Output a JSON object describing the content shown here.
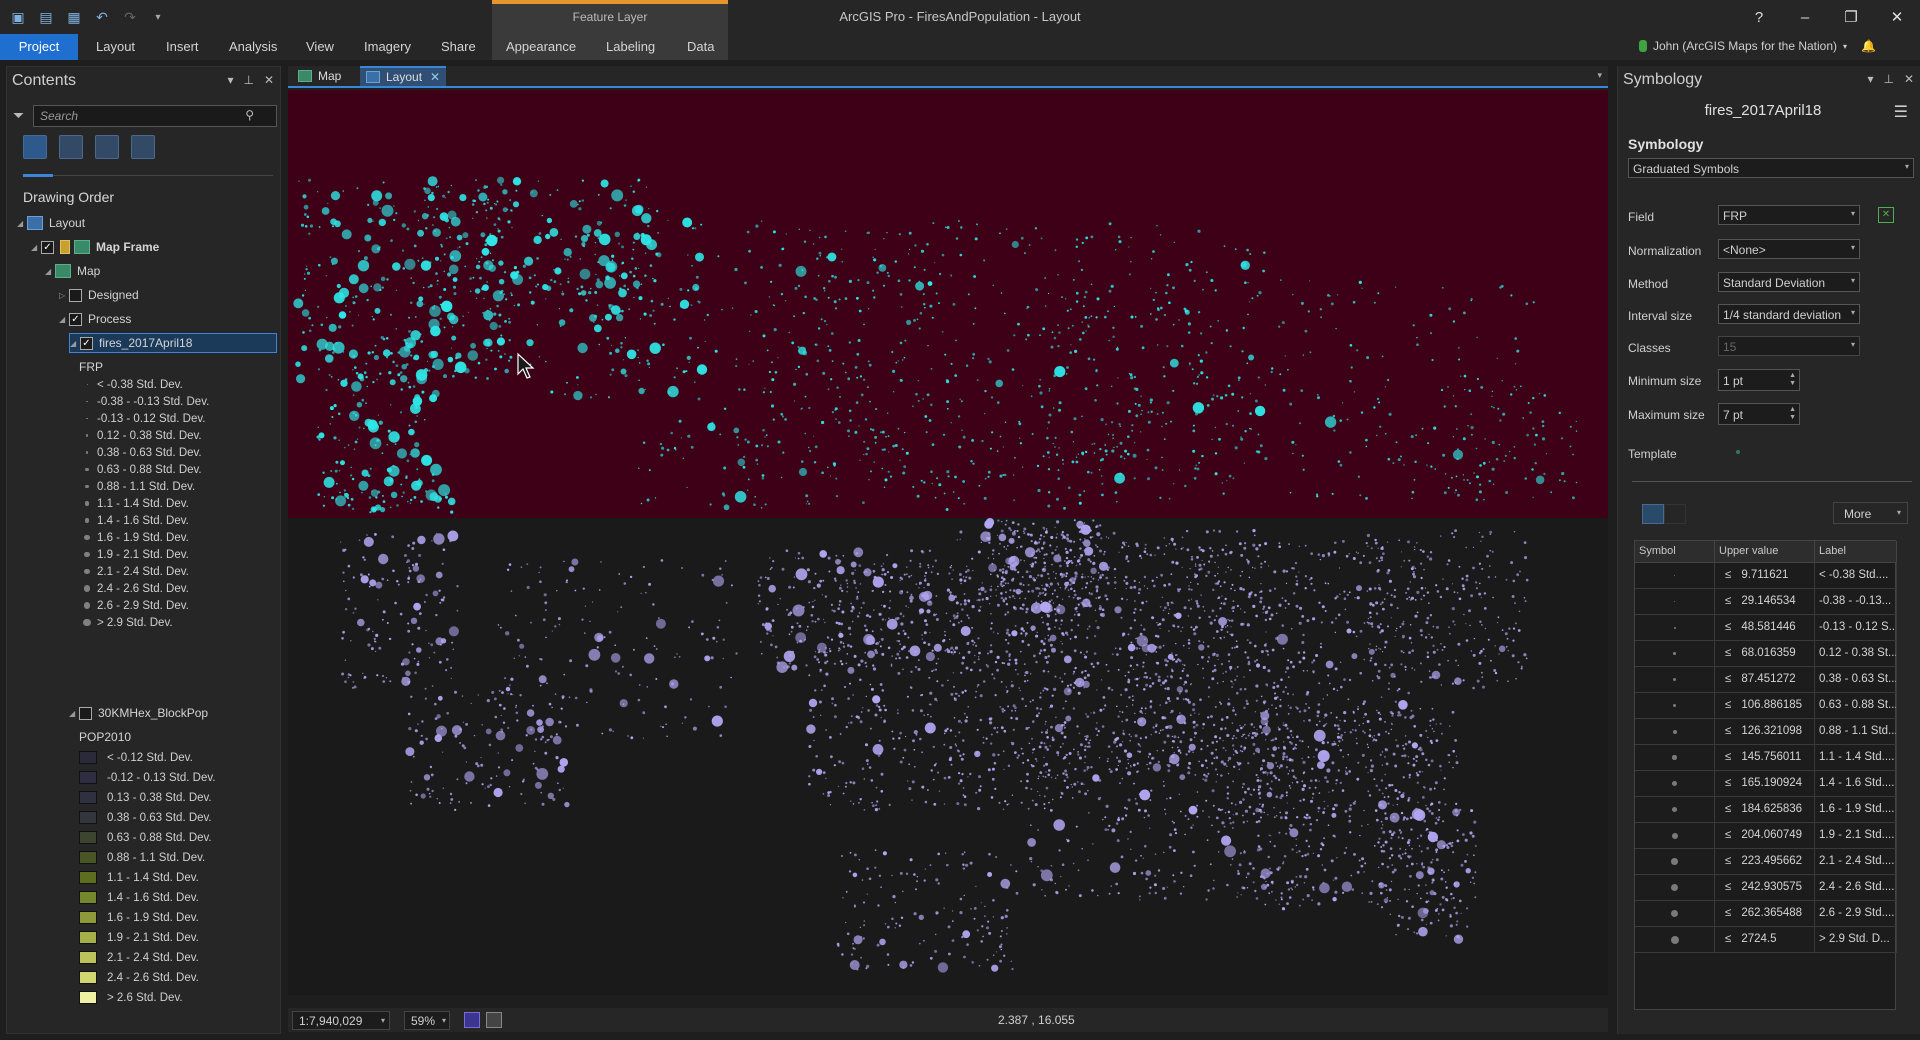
{
  "window": {
    "title": "ArcGIS Pro - FiresAndPopulation - Layout",
    "context_tab_title": "Feature Layer",
    "controls": [
      "?",
      "–",
      "❐",
      "✕"
    ]
  },
  "quick_access": [
    "project-icon",
    "open-icon",
    "save-icon",
    "undo-icon",
    "redo-icon",
    "customize-icon"
  ],
  "ribbon": {
    "tabs": [
      "Project",
      "Layout",
      "Insert",
      "Analysis",
      "View",
      "Imagery",
      "Share",
      "Appearance",
      "Labeling",
      "Data"
    ],
    "user": "John (ArcGIS Maps for the Nation)"
  },
  "contents": {
    "title": "Contents",
    "search_placeholder": "Search",
    "drawing_order": "Drawing Order",
    "tree": {
      "layout": "Layout",
      "map_frame": "Map Frame",
      "map": "Map",
      "designed": "Designed",
      "process": "Process",
      "fires_layer": "fires_2017April18",
      "fires_field": "FRP",
      "fires_classes": [
        "< -0.38 Std. Dev.",
        "-0.38 - -0.13 Std. Dev.",
        "-0.13 - 0.12 Std. Dev.",
        "0.12 - 0.38 Std. Dev.",
        "0.38 - 0.63 Std. Dev.",
        "0.63 - 0.88 Std. Dev.",
        "0.88 - 1.1 Std. Dev.",
        "1.1 - 1.4 Std. Dev.",
        "1.4 - 1.6 Std. Dev.",
        "1.6 - 1.9 Std. Dev.",
        "1.9 - 2.1 Std. Dev.",
        "2.1 - 2.4 Std. Dev.",
        "2.4 - 2.6 Std. Dev.",
        "2.6 - 2.9 Std. Dev.",
        "> 2.9 Std. Dev."
      ],
      "hex_layer": "30KMHex_BlockPop",
      "hex_field": "POP2010",
      "hex_classes": [
        "< -0.12 Std. Dev.",
        "-0.12 - 0.13 Std. Dev.",
        "0.13 - 0.38 Std. Dev.",
        "0.38 - 0.63 Std. Dev.",
        "0.63 - 0.88 Std. Dev.",
        "0.88 - 1.1 Std. Dev.",
        "1.1 - 1.4 Std. Dev.",
        "1.4 - 1.6 Std. Dev.",
        "1.6 - 1.9 Std. Dev.",
        "1.9 - 2.1 Std. Dev.",
        "2.1 - 2.4 Std. Dev.",
        "2.4 - 2.6 Std. Dev.",
        "> 2.6 Std. Dev."
      ],
      "hex_colors": [
        "#2a2a3a",
        "#2e2d42",
        "#2f3040",
        "#33363c",
        "#3d4430",
        "#4a5526",
        "#5f6e1e",
        "#76862a",
        "#8e9a3a",
        "#a5b048",
        "#bcc35a",
        "#d2d672",
        "#eef0a4"
      ]
    }
  },
  "doc_tabs": {
    "map": "Map",
    "layout": "Layout"
  },
  "status": {
    "scale": "1:7,940,029",
    "zoom": "59%",
    "coords": "2.387 , 16.055"
  },
  "map_colors": {
    "top_bg": "#3d0016",
    "bottom_bg": "#1a1a1a",
    "fire": "#2ee6e6",
    "pop": "#b3a6f2"
  },
  "symbology": {
    "pane_title": "Symbology",
    "layer": "fires_2017April18",
    "heading": "Symbology",
    "renderer": "Graduated Symbols",
    "field_label": "Field",
    "field": "FRP",
    "normalization_label": "Normalization",
    "normalization": "<None>",
    "method_label": "Method",
    "method": "Standard Deviation",
    "interval_label": "Interval size",
    "interval": "1/4 standard deviation",
    "classes_label": "Classes",
    "classes": "15",
    "min_label": "Minimum size",
    "min": "1 pt",
    "max_label": "Maximum size",
    "max": "7 pt",
    "template_label": "Template",
    "more": "More",
    "table_headers": [
      "Symbol",
      "Upper value",
      "Label"
    ],
    "rows": [
      {
        "upper": "9.711621",
        "label": "< -0.38 Std...."
      },
      {
        "upper": "29.146534",
        "label": "-0.38 - -0.13..."
      },
      {
        "upper": "48.581446",
        "label": "-0.13 - 0.12 S..."
      },
      {
        "upper": "68.016359",
        "label": "0.12 - 0.38 St..."
      },
      {
        "upper": "87.451272",
        "label": "0.38 - 0.63 St..."
      },
      {
        "upper": "106.886185",
        "label": "0.63 - 0.88 St..."
      },
      {
        "upper": "126.321098",
        "label": "0.88 - 1.1 Std...."
      },
      {
        "upper": "145.756011",
        "label": "1.1 - 1.4 Std...."
      },
      {
        "upper": "165.190924",
        "label": "1.4 - 1.6 Std...."
      },
      {
        "upper": "184.625836",
        "label": "1.6 - 1.9 Std...."
      },
      {
        "upper": "204.060749",
        "label": "1.9 - 2.1 Std...."
      },
      {
        "upper": "223.495662",
        "label": "2.1 - 2.4 Std...."
      },
      {
        "upper": "242.930575",
        "label": "2.4 - 2.6 Std...."
      },
      {
        "upper": "262.365488",
        "label": "2.6 - 2.9 Std...."
      },
      {
        "upper": "2724.5",
        "label": "> 2.9 Std. D..."
      }
    ]
  }
}
